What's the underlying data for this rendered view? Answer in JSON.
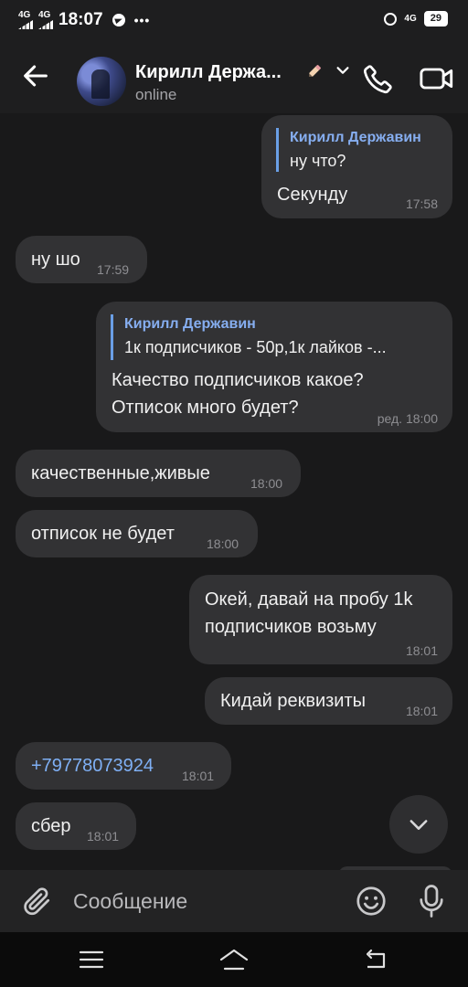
{
  "status_bar": {
    "network1": "4G",
    "network2": "4G",
    "time": "18:07",
    "more": "•••",
    "right_network": "4G",
    "battery": "29"
  },
  "header": {
    "contact_name": "Кирилл Держа...",
    "status": "online"
  },
  "messages": [
    {
      "direction": "outgoing",
      "reply_name": "Кирилл Державин",
      "reply_text": "ну что?",
      "text": "Секунду",
      "time": "17:58"
    },
    {
      "direction": "incoming",
      "text": "ну шо",
      "time": "17:59"
    },
    {
      "direction": "outgoing",
      "reply_name": "Кирилл Державин",
      "reply_text": "1к подписчиков - 50р,1к лайков -...",
      "text_line1": "Качество подписчиков какое?",
      "text_line2": "Отписок много будет?",
      "time": "ред. 18:00"
    },
    {
      "direction": "incoming",
      "text": "качественные,живые",
      "time": "18:00"
    },
    {
      "direction": "incoming",
      "text": "отписок не будет",
      "time": "18:00"
    },
    {
      "direction": "outgoing",
      "text_line1": "Окей, давай на пробу 1k",
      "text_line2": "подписчиков возьму",
      "time": "18:01"
    },
    {
      "direction": "outgoing",
      "text": "Кидай реквизиты",
      "time": "18:01"
    },
    {
      "direction": "incoming",
      "text": "+79778073924",
      "time": "18:01",
      "is_link": true
    },
    {
      "direction": "incoming",
      "text": "сбер",
      "time": "18:01"
    }
  ],
  "composer": {
    "placeholder": "Сообщение",
    "value": ""
  },
  "icons": [
    "back-arrow-icon",
    "pencil-icon",
    "chevron-down-icon",
    "phone-icon",
    "video-camera-icon",
    "chevron-down-icon",
    "paperclip-icon",
    "emoji-icon",
    "microphone-icon",
    "menu-icon",
    "home-icon",
    "back-icon"
  ],
  "colors": {
    "background": "#19191a",
    "bubble": "#323234",
    "accent": "#86aef0",
    "link": "#7fb0f5"
  }
}
